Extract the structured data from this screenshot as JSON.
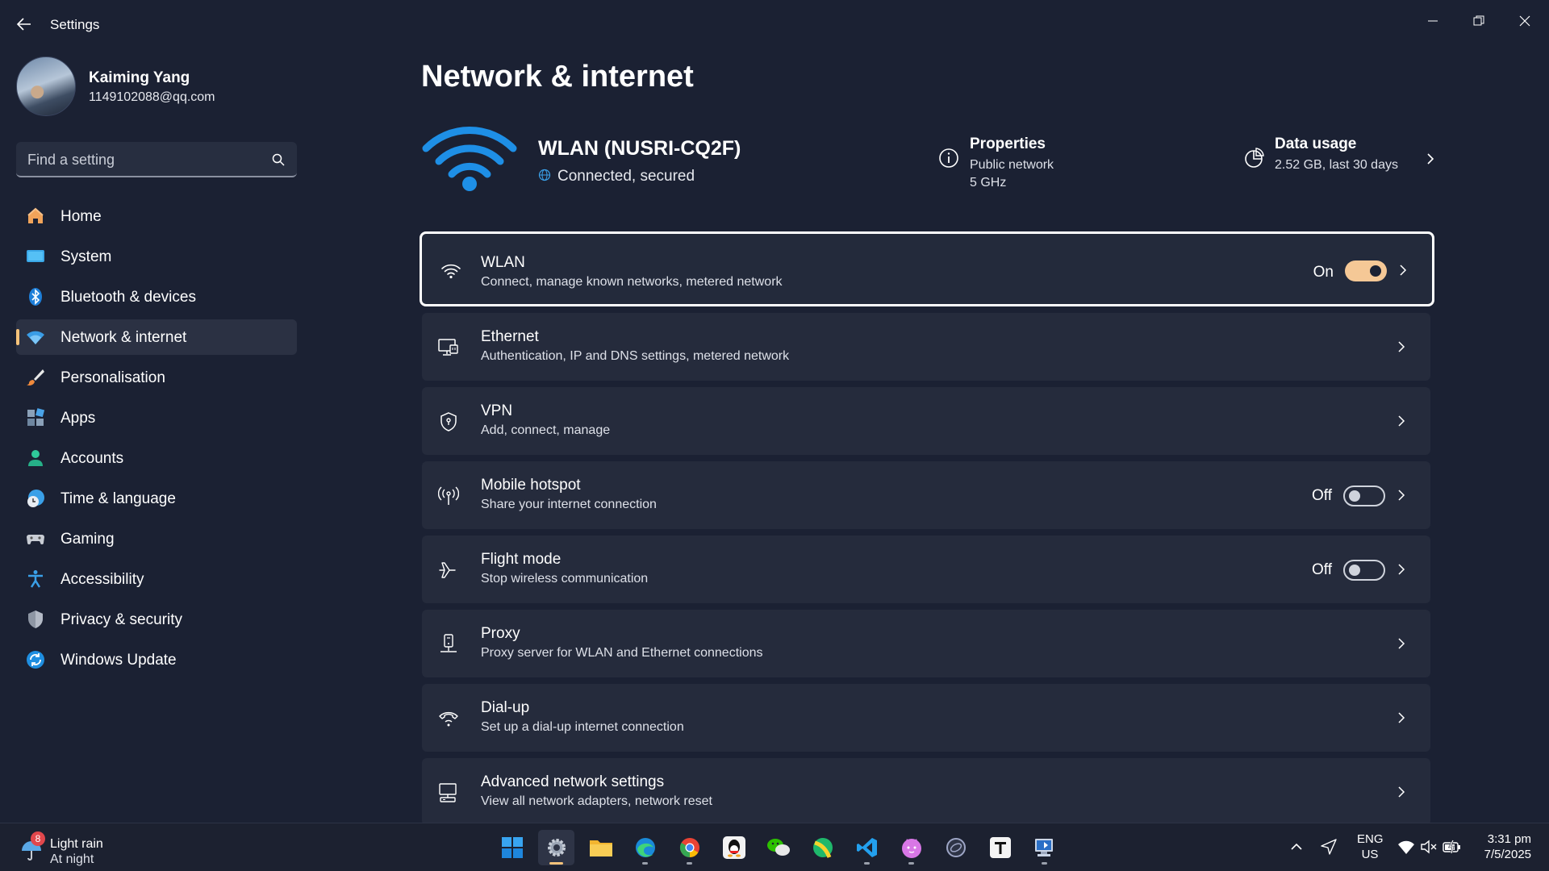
{
  "window": {
    "title": "Settings"
  },
  "profile": {
    "name": "Kaiming Yang",
    "email": "1149102088@qq.com"
  },
  "search": {
    "placeholder": "Find a setting"
  },
  "sidebar": {
    "items": [
      {
        "label": "Home",
        "icon": "home-icon"
      },
      {
        "label": "System",
        "icon": "system-icon"
      },
      {
        "label": "Bluetooth & devices",
        "icon": "bluetooth-icon"
      },
      {
        "label": "Network & internet",
        "icon": "wifi-icon",
        "active": true
      },
      {
        "label": "Personalisation",
        "icon": "brush-icon"
      },
      {
        "label": "Apps",
        "icon": "apps-icon"
      },
      {
        "label": "Accounts",
        "icon": "person-icon"
      },
      {
        "label": "Time & language",
        "icon": "clock-globe-icon"
      },
      {
        "label": "Gaming",
        "icon": "gamepad-icon"
      },
      {
        "label": "Accessibility",
        "icon": "accessibility-icon"
      },
      {
        "label": "Privacy & security",
        "icon": "shield-icon"
      },
      {
        "label": "Windows Update",
        "icon": "update-icon"
      }
    ]
  },
  "main": {
    "title": "Network & internet",
    "connection": {
      "name": "WLAN (NUSRI-CQ2F)",
      "status": "Connected, secured"
    },
    "properties": {
      "title": "Properties",
      "line1": "Public network",
      "line2": "5 GHz"
    },
    "data_usage": {
      "title": "Data usage",
      "line1": "2.52 GB, last 30 days"
    },
    "cards": [
      {
        "title": "WLAN",
        "subtitle": "Connect, manage known networks, metered network",
        "toggle_label": "On",
        "toggle": "on"
      },
      {
        "title": "Ethernet",
        "subtitle": "Authentication, IP and DNS settings, metered network"
      },
      {
        "title": "VPN",
        "subtitle": "Add, connect, manage"
      },
      {
        "title": "Mobile hotspot",
        "subtitle": "Share your internet connection",
        "toggle_label": "Off",
        "toggle": "off"
      },
      {
        "title": "Flight mode",
        "subtitle": "Stop wireless communication",
        "toggle_label": "Off",
        "toggle": "off"
      },
      {
        "title": "Proxy",
        "subtitle": "Proxy server for WLAN and Ethernet connections"
      },
      {
        "title": "Dial-up",
        "subtitle": "Set up a dial-up internet connection"
      },
      {
        "title": "Advanced network settings",
        "subtitle": "View all network adapters, network reset"
      }
    ]
  },
  "taskbar": {
    "weather": {
      "line1": "Light rain",
      "line2": "At night",
      "badge": "8"
    },
    "lang": {
      "line1": "ENG",
      "line2": "US"
    },
    "clock": {
      "time": "3:31 pm",
      "date": "7/5/2025"
    }
  },
  "colors": {
    "accent": "#f5c27a",
    "background": "#1b2133",
    "card": "#252b3c",
    "wifi_blue": "#1e8fe6"
  }
}
